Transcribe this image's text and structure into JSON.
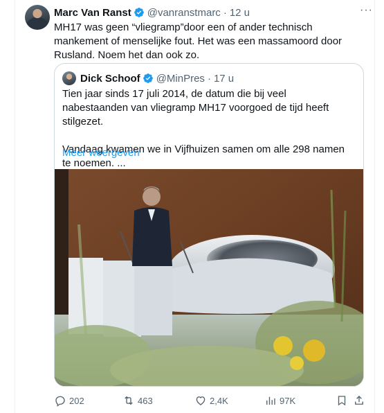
{
  "tweet": {
    "author_name": "Marc Van Ranst",
    "handle": "@vanranstmarc",
    "separator": "·",
    "time": "12 u",
    "more": "···",
    "text": "MH17 was geen “vliegramp”door een of ander technisch mankement of menselijke fout. Het was een massamoord door Rusland. Noem het dan ook zo."
  },
  "quote": {
    "author_name": "Dick Schoof",
    "handle": "@MinPres",
    "separator": "·",
    "time": "17 u",
    "paragraph1": "Tien jaar sinds 17 juli 2014, de datum die bij veel nabestaanden van vliegramp MH17 voorgoed de tijd heeft stilgezet.",
    "paragraph2": "Vandaag kwamen we in Vijfhuizen samen om alle 298 namen te noemen. ...",
    "show_more": "Meer weergeven"
  },
  "actions": {
    "replies": "202",
    "reposts": "463",
    "likes": "2,4K",
    "views": "97K"
  },
  "colors": {
    "verified": "#1d9bf0",
    "link": "#1d9bf0",
    "muted": "#536471",
    "border": "#cfd9de"
  }
}
